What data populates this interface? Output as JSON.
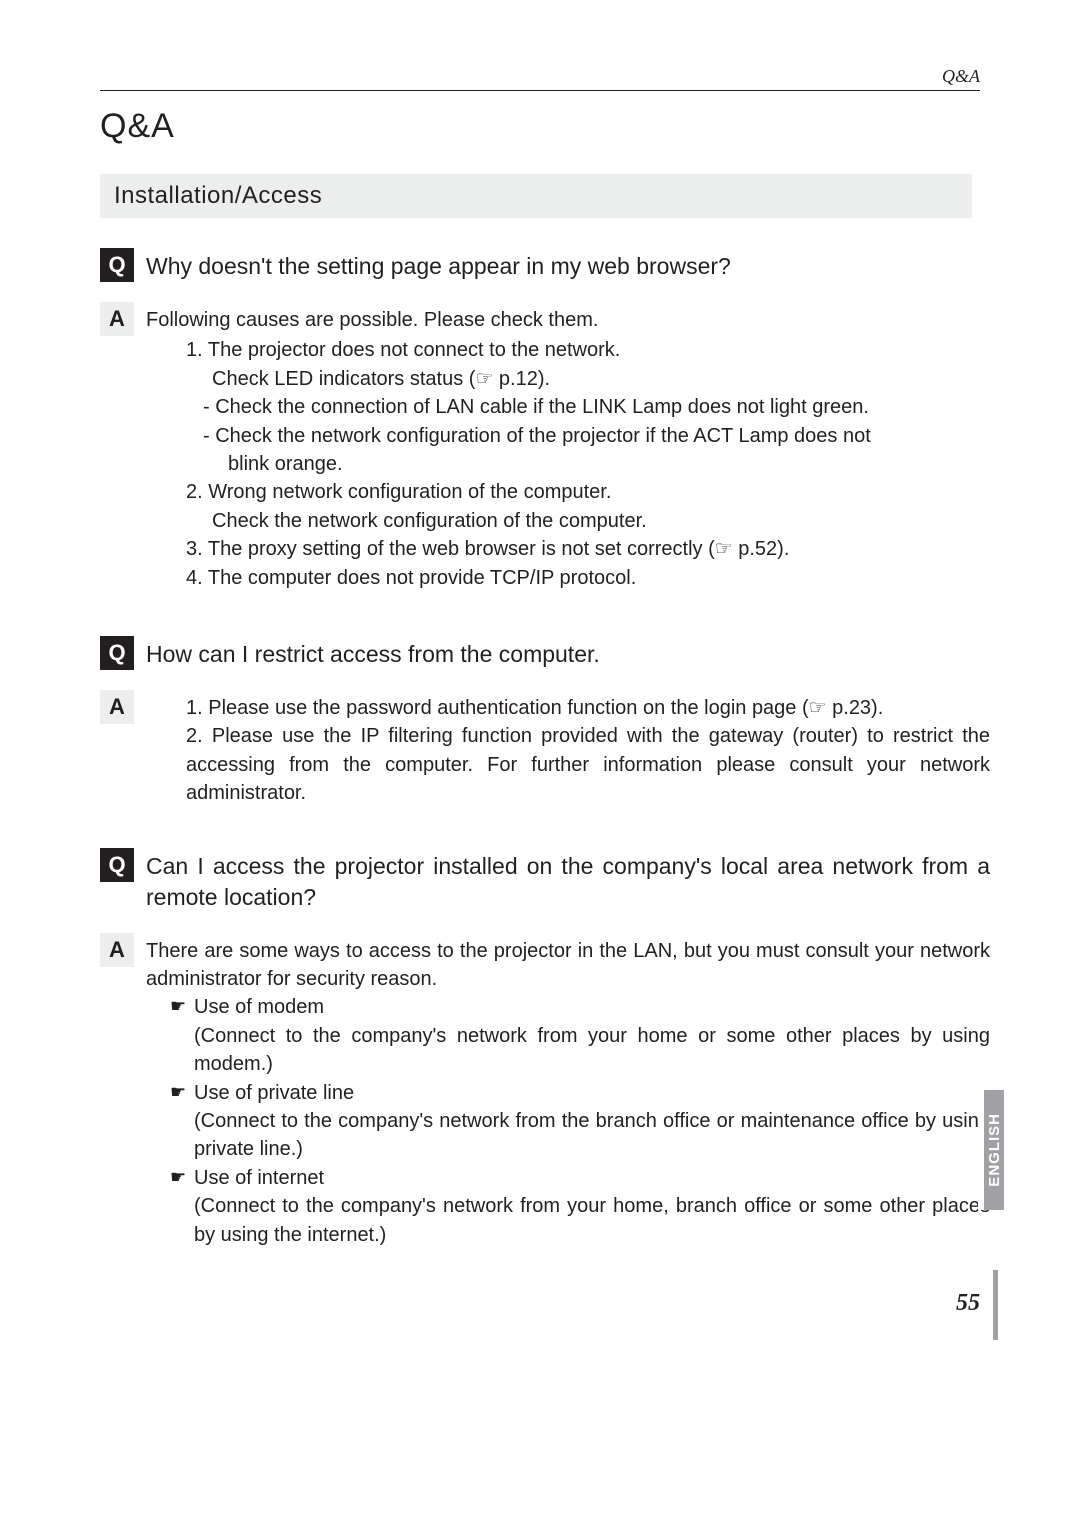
{
  "header": {
    "label": "Q&A"
  },
  "title": "Q&A",
  "section": "Installation/Access",
  "ref_icon": "☞",
  "hand_icon": "☛",
  "qa": [
    {
      "q": "Why doesn't the setting page appear in my web browser?",
      "a_intro": "Following causes are possible. Please check them.",
      "a_items": [
        "1. The projector does not connect to the network.",
        "Check LED indicators status (☞ p.12).",
        "- Check the connection of LAN cable if the LINK Lamp does not light green.",
        "- Check the network configuration of the projector if the ACT Lamp does not",
        "blink orange.",
        "2. Wrong network configuration of the computer.",
        "Check the network configuration of the computer.",
        "3. The proxy setting of the web browser is not set correctly (☞ p.52).",
        "4. The computer does not provide TCP/IP protocol."
      ]
    },
    {
      "q": "How can I restrict access from the computer.",
      "a_items": [
        "1. Please use the password authentication function on the login page (☞ p.23).",
        "2. Please use the IP filtering function provided with the gateway (router) to restrict the accessing from the computer. For further information please consult your network administrator."
      ]
    },
    {
      "q": "Can I access the projector installed on the company's local area network from a remote location?",
      "a_intro": "There are some ways to access to the projector in the LAN, but you must consult your network administrator for security reason.",
      "a_bullets": [
        {
          "title": "Use of modem",
          "sub": "(Connect to the company's network from your home or some other places by using modem.)"
        },
        {
          "title": "Use of private line",
          "sub": "(Connect to the company's network from the branch office or maintenance office by using private line.)"
        },
        {
          "title": "Use of internet",
          "sub": "(Connect to the company's network from your home, branch office or some other places by using the internet.)"
        }
      ]
    }
  ],
  "side_tab": "ENGLISH",
  "page_number": "55"
}
